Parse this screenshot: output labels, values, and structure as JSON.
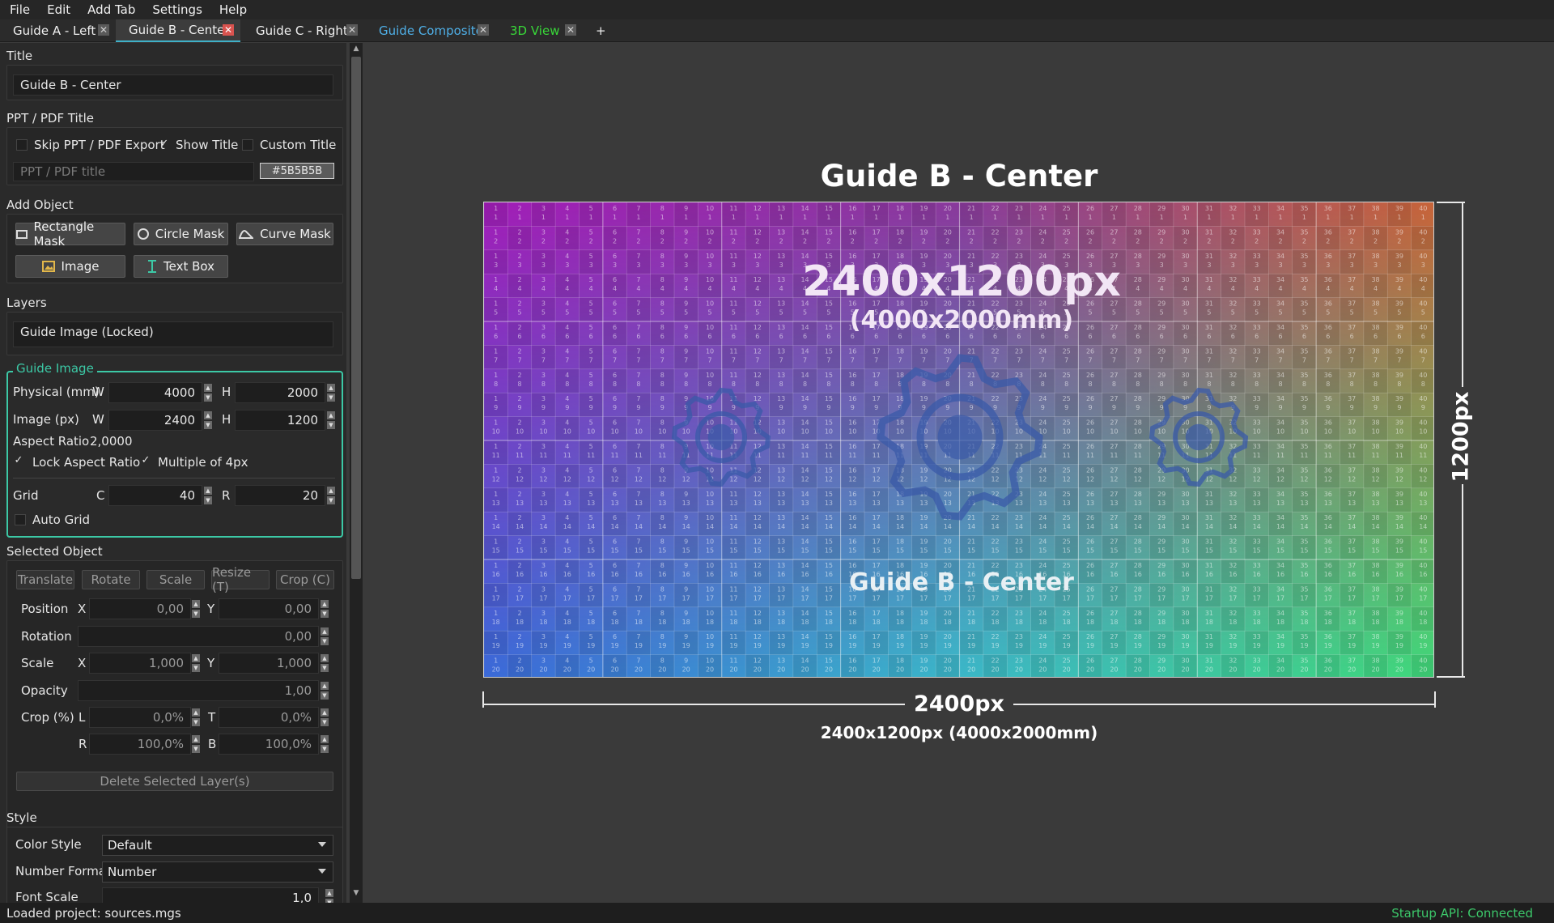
{
  "menu": [
    "File",
    "Edit",
    "Add Tab",
    "Settings",
    "Help"
  ],
  "tabs": [
    {
      "label": "Guide A - Left",
      "color": "#f0f0f0"
    },
    {
      "label": "Guide B - Center",
      "color": "#f0f0f0",
      "active": true
    },
    {
      "label": "Guide C - Right",
      "color": "#f0f0f0"
    },
    {
      "label": "Guide Composite",
      "color": "#4fb0e8"
    },
    {
      "label": "3D View",
      "color": "#38d838"
    }
  ],
  "add_tab_label": "+",
  "panel": {
    "title_section": "Title",
    "title_value": "Guide B - Center",
    "ppt_section": "PPT / PDF Title",
    "skip_export_label": "Skip PPT / PDF Export",
    "show_title_label": "Show Title",
    "custom_title_label": "Custom Title",
    "ppt_placeholder": "PPT / PDF title",
    "title_color": "#5B5B5B",
    "add_object_section": "Add Object",
    "rect_mask": "Rectangle Mask",
    "circle_mask": "Circle Mask",
    "curve_mask": "Curve Mask",
    "image": "Image",
    "text_box": "Text Box",
    "layers_section": "Layers",
    "layer_item": "Guide Image (Locked)",
    "guide_image_section": "Guide Image",
    "physical_label": "Physical (mm)",
    "w_label": "W",
    "h_label": "H",
    "physical_w": "4000",
    "physical_h": "2000",
    "image_px_label": "Image (px)",
    "image_w": "2400",
    "image_h": "1200",
    "aspect_label": "Aspect Ratio",
    "aspect_value": "2,0000",
    "lock_aspect": "Lock Aspect Ratio",
    "multiple_4": "Multiple of 4px",
    "grid_label": "Grid",
    "c_label": "C",
    "r_label": "R",
    "grid_c": "40",
    "grid_r": "20",
    "auto_grid": "Auto Grid",
    "selected_section": "Selected Object",
    "translate": "Translate",
    "rotate": "Rotate",
    "scale": "Scale",
    "resize": "Resize (T)",
    "crop": "Crop (C)",
    "position_label": "Position",
    "x_label": "X",
    "y_label": "Y",
    "pos_x": "0,00",
    "pos_y": "0,00",
    "rotation_label": "Rotation",
    "rotation_value": "0,00",
    "scale_label": "Scale",
    "scale_x": "1,000",
    "scale_y": "1,000",
    "opacity_label": "Opacity",
    "opacity_value": "1,00",
    "crop_label": "Crop (%)",
    "l_label": "L",
    "t_label": "T",
    "crop_l": "0,0%",
    "crop_t": "0,0%",
    "r2_label": "R",
    "b_label": "B",
    "crop_r": "100,0%",
    "crop_b": "100,0%",
    "delete_layers": "Delete Selected Layer(s)",
    "style_section": "Style",
    "color_style_label": "Color Style",
    "color_style_value": "Default",
    "number_format_label": "Number Format",
    "number_format_value": "Number",
    "font_scale_label": "Font Scale",
    "font_scale_value": "1,0"
  },
  "canvas": {
    "guide_title": "Guide B - Center",
    "big_px": "2400x1200px",
    "big_mm": "(4000x2000mm)",
    "inner_title": "Guide B - Center",
    "width_dim": "2400px",
    "height_dim": "1200px",
    "caption": "2400x1200px (4000x2000mm)",
    "grid_cols": 40,
    "grid_rows": 20
  },
  "status": {
    "left": "Loaded project: sources.mgs",
    "right": "Startup API: Connected"
  }
}
